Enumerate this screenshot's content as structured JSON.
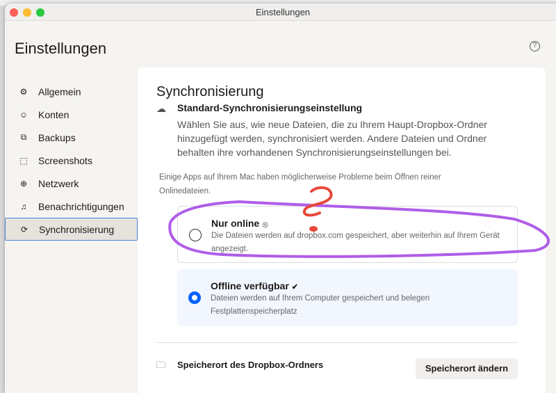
{
  "window": {
    "title": "Einstellungen"
  },
  "header": {
    "title": "Einstellungen",
    "help_icon": "?"
  },
  "sidebar": {
    "items": [
      {
        "label": "Allgemein",
        "icon": "gear-icon",
        "glyph": "⚙"
      },
      {
        "label": "Konten",
        "icon": "user-icon",
        "glyph": "☺"
      },
      {
        "label": "Backups",
        "icon": "backup-icon",
        "glyph": "⧉"
      },
      {
        "label": "Screenshots",
        "icon": "screenshot-icon",
        "glyph": "⬚"
      },
      {
        "label": "Netzwerk",
        "icon": "globe-icon",
        "glyph": "⊕"
      },
      {
        "label": "Benachrichtigungen",
        "icon": "bell-icon",
        "glyph": "♫"
      },
      {
        "label": "Synchronisierung",
        "icon": "sync-icon",
        "glyph": "⟳",
        "active": true
      }
    ]
  },
  "main": {
    "section_title": "Synchronisierung",
    "subtitle": "Standard-Synchronisierungseinstellung",
    "description": "Wählen Sie aus, wie neue Dateien, die zu Ihrem Haupt-Dropbox-Ordner hinzugefügt werden, synchronisiert werden. Andere Dateien und Ordner behalten ihre vorhandenen Synchronisierungseinstellungen bei.",
    "note": "Einige Apps auf Ihrem Mac haben möglicherweise Probleme beim Öffnen reiner Onlinedateien.",
    "options": [
      {
        "title": "Nur online",
        "description": "Die Dateien werden auf dropbox.com gespeichert, aber weiterhin auf Ihrem Gerät angezeigt.",
        "selected": false
      },
      {
        "title": "Offline verfügbar",
        "description": "Dateien werden auf Ihrem Computer gespeichert und belegen Festplattenspeicherplatz",
        "selected": true
      }
    ],
    "location_label": "Speicherort des Dropbox-Ordners",
    "change_location_button": "Speicherort ändern"
  },
  "colors": {
    "accent": "#0061fe",
    "annotation_purple": "#b05de8",
    "annotation_red": "#e8483a"
  }
}
